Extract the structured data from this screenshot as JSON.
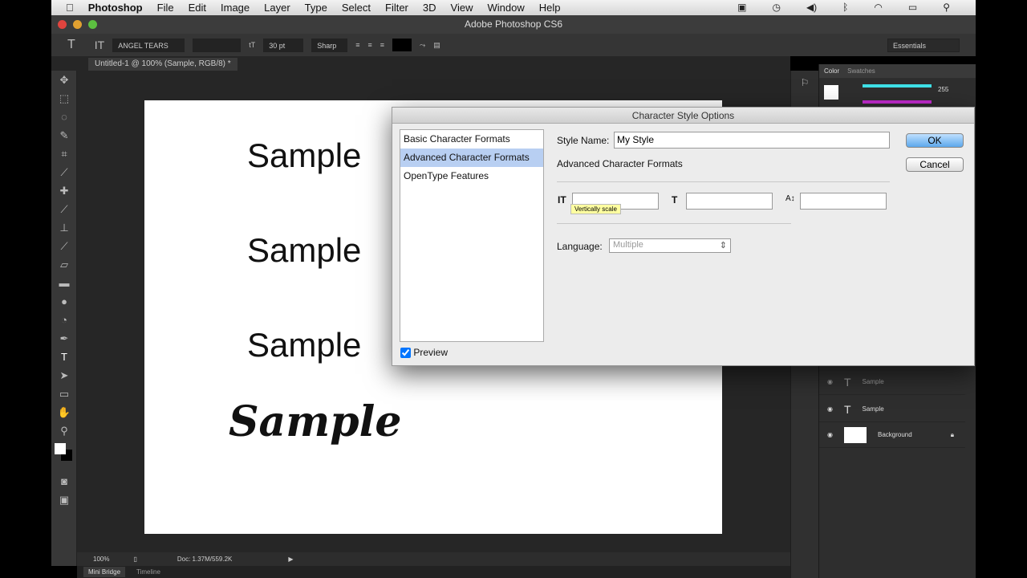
{
  "menubar": {
    "app": "Photoshop",
    "items": [
      "File",
      "Edit",
      "Image",
      "Layer",
      "Type",
      "Select",
      "Filter",
      "3D",
      "View",
      "Window",
      "Help"
    ]
  },
  "window": {
    "title": "Adobe Photoshop CS6"
  },
  "options": {
    "font": "ANGEL TEARS",
    "size": "30 pt",
    "antialias": "Sharp",
    "workspace": "Essentials"
  },
  "document": {
    "tab": "Untitled-1 @ 100% (Sample, RGB/8) *",
    "texts": [
      "Sample",
      "Sample",
      "Sample"
    ],
    "script_text": "Sample"
  },
  "status": {
    "zoom": "100%",
    "doc": "Doc: 1.37M/559.2K"
  },
  "bottom_tabs": [
    "Mini Bridge",
    "Timeline"
  ],
  "color_panel": {
    "tabs": [
      "Color",
      "Swatches"
    ],
    "value1": "255",
    "colors": {
      "slider1": "#3fe0e6",
      "slider2": "#c42bd0"
    }
  },
  "layers": [
    "Sample",
    "Sample",
    "Background"
  ],
  "dialog": {
    "title": "Character Style Options",
    "categories": [
      "Basic Character Formats",
      "Advanced Character Formats",
      "OpenType Features"
    ],
    "style_name_label": "Style Name:",
    "style_name": "My Style",
    "section": "Advanced Character Formats",
    "tooltip": "Vertically scale",
    "language_label": "Language:",
    "language": "Multiple",
    "preview_label": "Preview",
    "ok": "OK",
    "cancel": "Cancel"
  }
}
